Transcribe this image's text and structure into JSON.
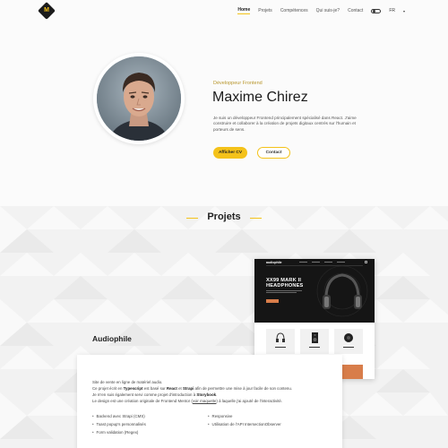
{
  "nav": {
    "logo_letter": "M",
    "links": [
      {
        "label": "Home",
        "active": true
      },
      {
        "label": "Projets",
        "active": false
      },
      {
        "label": "Compétences",
        "active": false
      },
      {
        "label": "Qui suis-je?",
        "active": false
      },
      {
        "label": "Contact",
        "active": false
      }
    ],
    "lang": "FR",
    "lang_caret": "▾",
    "theme_toggle_icon": "theme-toggle-icon"
  },
  "hero": {
    "eyebrow": "Développeur Frontend",
    "name": "Maxime Chirez",
    "description": "Je suis un développeur Frontend principalement spécialisé dans React. J'aime construire et collaborer à la création de projets digitaux centrés sur l'humain et porteurs de sens.",
    "cv_button": "Afficher CV",
    "contact_button": "Contact"
  },
  "projects": {
    "title": "Projets",
    "current": {
      "name": "Audiophile",
      "preview": {
        "brand": "audiophile",
        "heading": "XX99 MARK II HEADPHONES"
      },
      "paragraphs": [
        {
          "before": "Site de vente en ligne de matériel audio.",
          "bold1": "",
          "mid": "",
          "bold2": "",
          "after": ""
        },
        {
          "before": "Ce projet écrit en ",
          "bold1": "Typescript",
          "mid": " est basé sur ",
          "bold2": "React",
          "mid2": " et ",
          "bold3": "Strapi",
          "after": " afin de permettre une mise à jour facile de son contenu."
        },
        {
          "before": "Je m'en suis également servi comme projet d'introduction à ",
          "bold1": "Storybook",
          "after": "."
        },
        {
          "before": "Le design est une création originale de Frontend Mentor (",
          "link": "voir maquette",
          "after": ") à laquelle j'ai ajouté de l'interactivité."
        }
      ],
      "features_left": [
        "Backend avec Strapi (CMS)",
        "Toast popup's personnalisés",
        "Form validation (Regex)"
      ],
      "features_right": [
        "Responsive",
        "Utilisation de l'API IntersectionObserver"
      ]
    }
  },
  "colors": {
    "accent": "#f4c21a",
    "dark": "#1c1c1c",
    "orange": "#d87d4a"
  }
}
